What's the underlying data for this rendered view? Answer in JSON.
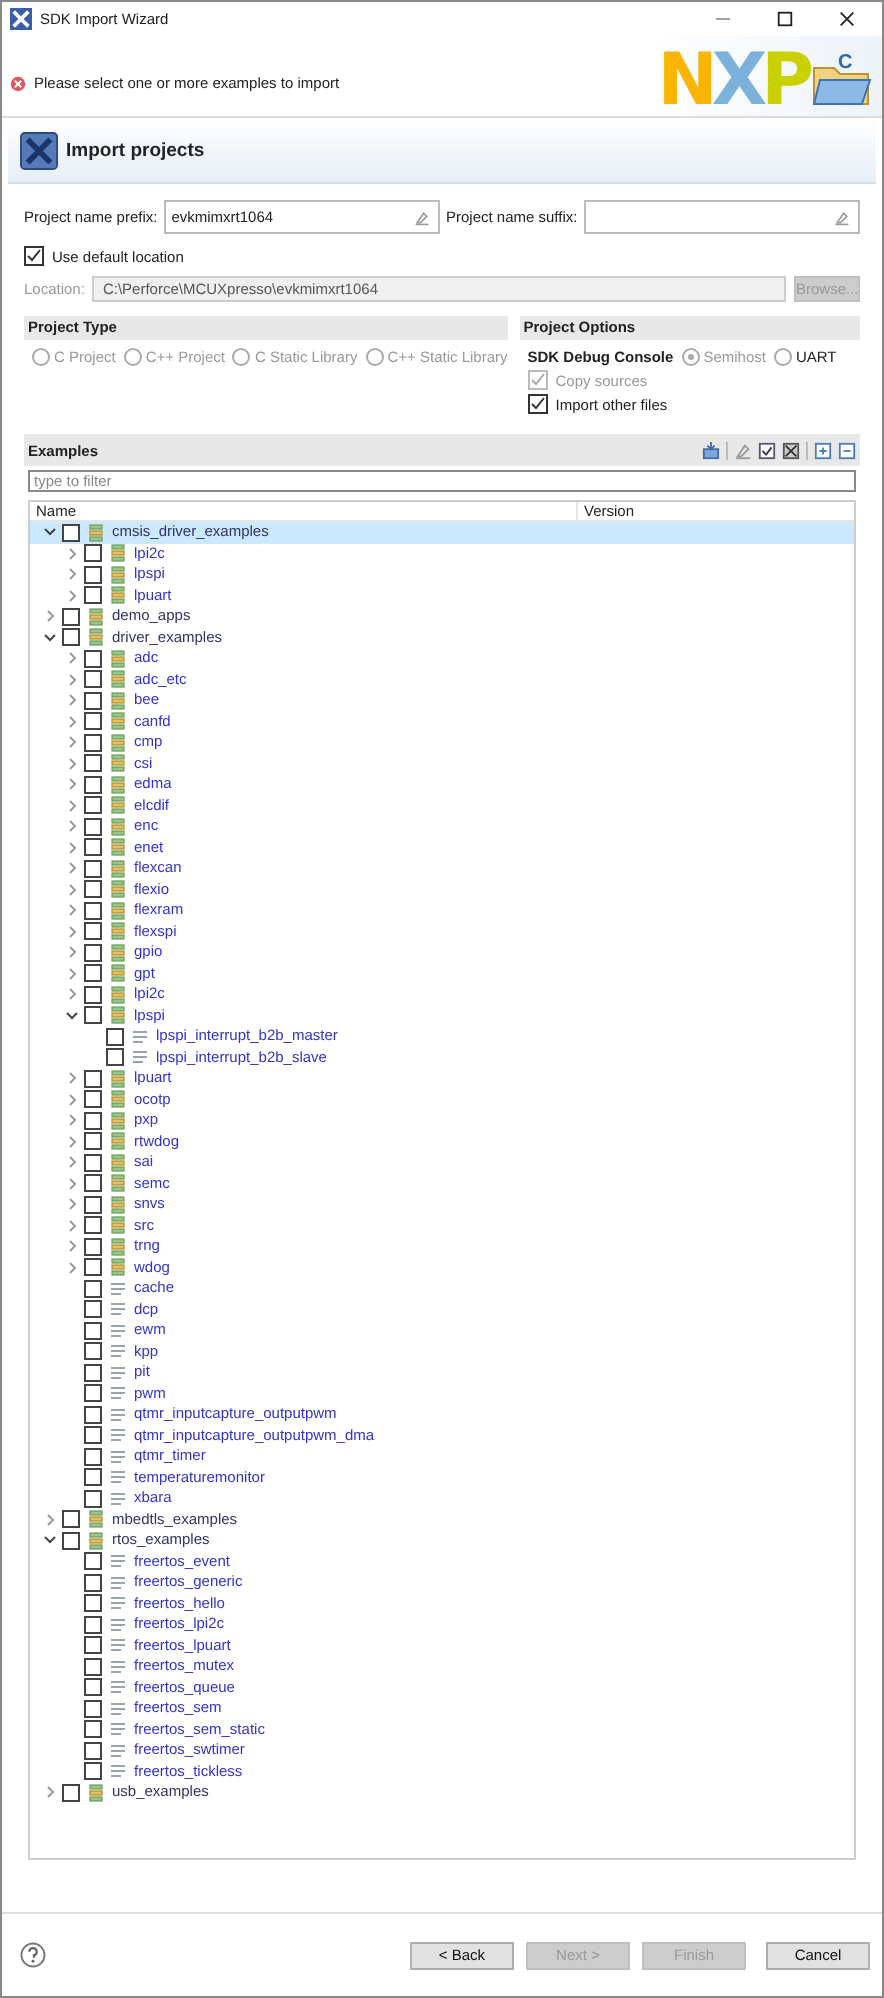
{
  "window": {
    "title": "SDK Import Wizard"
  },
  "message": {
    "kind": "error",
    "text": "Please select one or more examples to import"
  },
  "logo": {
    "text": "NXP",
    "badge": "C"
  },
  "page_title": "Import projects",
  "form": {
    "prefix_label": "Project name prefix:",
    "prefix_value": "evkmimxrt1064",
    "suffix_label": "Project name suffix:",
    "use_default_location": {
      "label": "Use default location",
      "checked": true
    },
    "location": {
      "label": "Location:",
      "value": "C:\\Perforce\\MCUXpresso\\evkmimxrt1064",
      "disabled": true
    },
    "browse": {
      "label": "Browse...",
      "disabled": true
    }
  },
  "project_type": {
    "title": "Project Type",
    "options": [
      {
        "label": "C Project",
        "selected": false,
        "disabled": true
      },
      {
        "label": "C++ Project",
        "selected": false,
        "disabled": true
      },
      {
        "label": "C Static Library",
        "selected": false,
        "disabled": true
      },
      {
        "label": "C++ Static Library",
        "selected": false,
        "disabled": true
      }
    ]
  },
  "project_options": {
    "title": "Project Options",
    "console_label": "SDK Debug Console",
    "console_options": [
      {
        "label": "Semihost",
        "selected": true,
        "disabled": true
      },
      {
        "label": "UART",
        "selected": false,
        "disabled": false
      }
    ],
    "checkboxes": [
      {
        "label": "Copy sources",
        "checked": true,
        "disabled": true
      },
      {
        "label": "Import other files",
        "checked": true,
        "disabled": false
      }
    ]
  },
  "examples": {
    "title": "Examples",
    "filter_placeholder": "type to filter",
    "columns": [
      "Name",
      "Version"
    ],
    "tree": [
      {
        "label": "cmsis_driver_examples",
        "kind": "group",
        "expanded": true,
        "checked": false,
        "selected": true,
        "children": [
          {
            "label": "lpi2c",
            "kind": "group",
            "expanded": false,
            "checked": false,
            "selected": false
          },
          {
            "label": "lpspi",
            "kind": "group",
            "expanded": false,
            "checked": false,
            "selected": false
          },
          {
            "label": "lpuart",
            "kind": "group",
            "expanded": false,
            "checked": false,
            "selected": false
          }
        ]
      },
      {
        "label": "demo_apps",
        "kind": "group",
        "expanded": false,
        "checked": false,
        "selected": false
      },
      {
        "label": "driver_examples",
        "kind": "group",
        "expanded": true,
        "checked": false,
        "selected": false,
        "children": [
          {
            "label": "adc",
            "kind": "group",
            "expanded": false,
            "checked": false,
            "selected": false
          },
          {
            "label": "adc_etc",
            "kind": "group",
            "expanded": false,
            "checked": false,
            "selected": false
          },
          {
            "label": "bee",
            "kind": "group",
            "expanded": false,
            "checked": false,
            "selected": false
          },
          {
            "label": "canfd",
            "kind": "group",
            "expanded": false,
            "checked": false,
            "selected": false
          },
          {
            "label": "cmp",
            "kind": "group",
            "expanded": false,
            "checked": false,
            "selected": false
          },
          {
            "label": "csi",
            "kind": "group",
            "expanded": false,
            "checked": false,
            "selected": false
          },
          {
            "label": "edma",
            "kind": "group",
            "expanded": false,
            "checked": false,
            "selected": false
          },
          {
            "label": "elcdif",
            "kind": "group",
            "expanded": false,
            "checked": false,
            "selected": false
          },
          {
            "label": "enc",
            "kind": "group",
            "expanded": false,
            "checked": false,
            "selected": false
          },
          {
            "label": "enet",
            "kind": "group",
            "expanded": false,
            "checked": false,
            "selected": false
          },
          {
            "label": "flexcan",
            "kind": "group",
            "expanded": false,
            "checked": false,
            "selected": false
          },
          {
            "label": "flexio",
            "kind": "group",
            "expanded": false,
            "checked": false,
            "selected": false
          },
          {
            "label": "flexram",
            "kind": "group",
            "expanded": false,
            "checked": false,
            "selected": false
          },
          {
            "label": "flexspi",
            "kind": "group",
            "expanded": false,
            "checked": false,
            "selected": false
          },
          {
            "label": "gpio",
            "kind": "group",
            "expanded": false,
            "checked": false,
            "selected": false
          },
          {
            "label": "gpt",
            "kind": "group",
            "expanded": false,
            "checked": false,
            "selected": false
          },
          {
            "label": "lpi2c",
            "kind": "group",
            "expanded": false,
            "checked": false,
            "selected": false
          },
          {
            "label": "lpspi",
            "kind": "group",
            "expanded": true,
            "checked": false,
            "selected": false,
            "children": [
              {
                "label": "lpspi_interrupt_b2b_master",
                "kind": "example",
                "checked": false,
                "selected": false
              },
              {
                "label": "lpspi_interrupt_b2b_slave",
                "kind": "example",
                "checked": false,
                "selected": false
              }
            ]
          },
          {
            "label": "lpuart",
            "kind": "group",
            "expanded": false,
            "checked": false,
            "selected": false
          },
          {
            "label": "ocotp",
            "kind": "group",
            "expanded": false,
            "checked": false,
            "selected": false
          },
          {
            "label": "pxp",
            "kind": "group",
            "expanded": false,
            "checked": false,
            "selected": false
          },
          {
            "label": "rtwdog",
            "kind": "group",
            "expanded": false,
            "checked": false,
            "selected": false
          },
          {
            "label": "sai",
            "kind": "group",
            "expanded": false,
            "checked": false,
            "selected": false
          },
          {
            "label": "semc",
            "kind": "group",
            "expanded": false,
            "checked": false,
            "selected": false
          },
          {
            "label": "snvs",
            "kind": "group",
            "expanded": false,
            "checked": false,
            "selected": false
          },
          {
            "label": "src",
            "kind": "group",
            "expanded": false,
            "checked": false,
            "selected": false
          },
          {
            "label": "trng",
            "kind": "group",
            "expanded": false,
            "checked": false,
            "selected": false
          },
          {
            "label": "wdog",
            "kind": "group",
            "expanded": false,
            "checked": false,
            "selected": false
          },
          {
            "label": "cache",
            "kind": "example",
            "checked": false,
            "selected": false
          },
          {
            "label": "dcp",
            "kind": "example",
            "checked": false,
            "selected": false
          },
          {
            "label": "ewm",
            "kind": "example",
            "checked": false,
            "selected": false
          },
          {
            "label": "kpp",
            "kind": "example",
            "checked": false,
            "selected": false
          },
          {
            "label": "pit",
            "kind": "example",
            "checked": false,
            "selected": false
          },
          {
            "label": "pwm",
            "kind": "example",
            "checked": false,
            "selected": false
          },
          {
            "label": "qtmr_inputcapture_outputpwm",
            "kind": "example",
            "checked": false,
            "selected": false
          },
          {
            "label": "qtmr_inputcapture_outputpwm_dma",
            "kind": "example",
            "checked": false,
            "selected": false
          },
          {
            "label": "qtmr_timer",
            "kind": "example",
            "checked": false,
            "selected": false
          },
          {
            "label": "temperaturemonitor",
            "kind": "example",
            "checked": false,
            "selected": false
          },
          {
            "label": "xbara",
            "kind": "example",
            "checked": false,
            "selected": false
          }
        ]
      },
      {
        "label": "mbedtls_examples",
        "kind": "group",
        "expanded": false,
        "checked": false,
        "selected": false
      },
      {
        "label": "rtos_examples",
        "kind": "group",
        "expanded": true,
        "checked": false,
        "selected": false,
        "children": [
          {
            "label": "freertos_event",
            "kind": "example",
            "checked": false,
            "selected": false
          },
          {
            "label": "freertos_generic",
            "kind": "example",
            "checked": false,
            "selected": false
          },
          {
            "label": "freertos_hello",
            "kind": "example",
            "checked": false,
            "selected": false
          },
          {
            "label": "freertos_lpi2c",
            "kind": "example",
            "checked": false,
            "selected": false
          },
          {
            "label": "freertos_lpuart",
            "kind": "example",
            "checked": false,
            "selected": false
          },
          {
            "label": "freertos_mutex",
            "kind": "example",
            "checked": false,
            "selected": false
          },
          {
            "label": "freertos_queue",
            "kind": "example",
            "checked": false,
            "selected": false
          },
          {
            "label": "freertos_sem",
            "kind": "example",
            "checked": false,
            "selected": false
          },
          {
            "label": "freertos_sem_static",
            "kind": "example",
            "checked": false,
            "selected": false
          },
          {
            "label": "freertos_swtimer",
            "kind": "example",
            "checked": false,
            "selected": false
          },
          {
            "label": "freertos_tickless",
            "kind": "example",
            "checked": false,
            "selected": false
          }
        ]
      },
      {
        "label": "usb_examples",
        "kind": "group",
        "expanded": false,
        "checked": false,
        "selected": false
      }
    ]
  },
  "buttons": [
    {
      "label": "< Back",
      "disabled": false
    },
    {
      "label": "Next >",
      "disabled": true
    },
    {
      "label": "Finish",
      "disabled": true
    },
    {
      "label": "Cancel",
      "disabled": false
    }
  ]
}
